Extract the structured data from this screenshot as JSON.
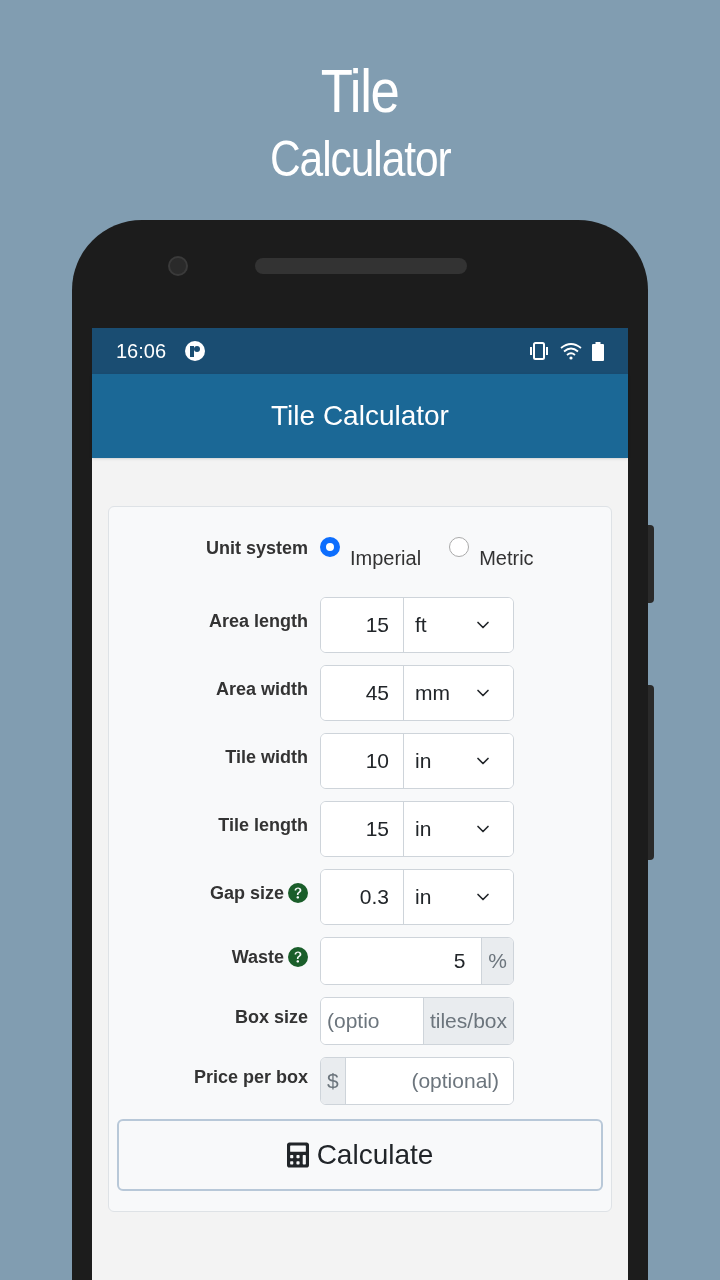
{
  "promo_title": [
    "Tile",
    "Calculator"
  ],
  "status_bar": {
    "time": "16:06"
  },
  "app_bar": {
    "title": "Tile Calculator"
  },
  "form": {
    "unit_system": {
      "label": "Unit system",
      "options": [
        {
          "label": "Imperial",
          "selected": true
        },
        {
          "label": "Metric",
          "selected": false
        }
      ]
    },
    "fields": [
      {
        "kind": "unit",
        "label": "Area length",
        "help": false,
        "value": "15",
        "unit": "ft"
      },
      {
        "kind": "unit",
        "label": "Area width",
        "help": false,
        "value": "45",
        "unit": "mm"
      },
      {
        "kind": "unit",
        "label": "Tile width",
        "help": false,
        "value": "10",
        "unit": "in"
      },
      {
        "kind": "unit",
        "label": "Tile length",
        "help": false,
        "value": "15",
        "unit": "in"
      },
      {
        "kind": "unit",
        "label": "Gap size",
        "help": true,
        "value": "0.3",
        "unit": "in"
      },
      {
        "kind": "suffix",
        "label": "Waste",
        "help": true,
        "value": "5",
        "addon": "%"
      },
      {
        "kind": "suffix",
        "label": "Box size",
        "help": false,
        "placeholder": "(optio",
        "addon": "tiles/box"
      },
      {
        "kind": "prefix",
        "label": "Price per box",
        "help": false,
        "placeholder": "(optional)",
        "addon": "$"
      }
    ],
    "button": "Calculate"
  }
}
